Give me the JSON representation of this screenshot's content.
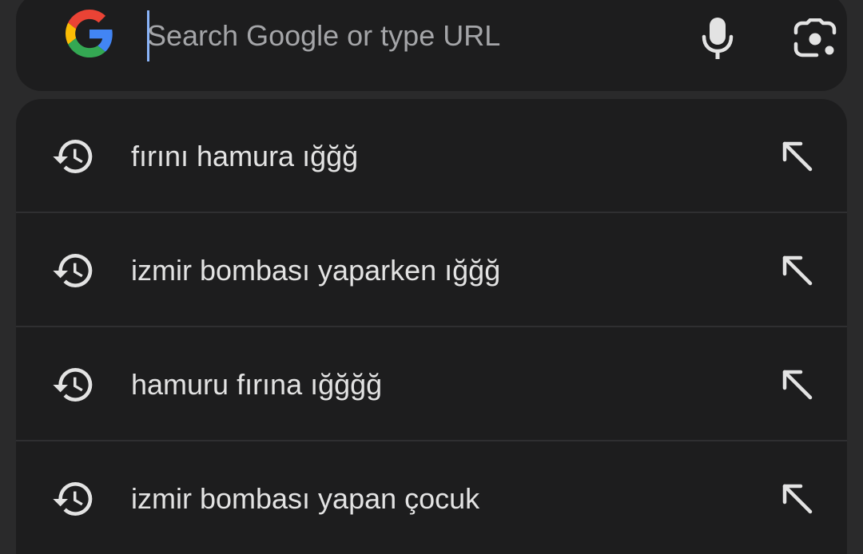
{
  "search": {
    "placeholder": "Search Google or type URL",
    "value": "",
    "logo_icon": "google-g-icon",
    "mic_icon": "mic-icon",
    "lens_icon": "lens-camera-icon"
  },
  "suggestions": [
    {
      "label": "fırını hamura ığğğ",
      "icon": "history-icon",
      "action_icon": "arrow-up-left-icon"
    },
    {
      "label": "izmir bombası yaparken ığğğ",
      "icon": "history-icon",
      "action_icon": "arrow-up-left-icon"
    },
    {
      "label": "hamuru fırına ığğğğ",
      "icon": "history-icon",
      "action_icon": "arrow-up-left-icon"
    },
    {
      "label": "izmir bombası yapan çocuk",
      "icon": "history-icon",
      "action_icon": "arrow-up-left-icon"
    }
  ],
  "colors": {
    "background": "#2a2a2b",
    "surface": "#1d1d1e",
    "text": "#e3e3e3",
    "placeholder": "#a4a5a8",
    "caret": "#8ab4f8",
    "icon": "#e3e3e3"
  }
}
